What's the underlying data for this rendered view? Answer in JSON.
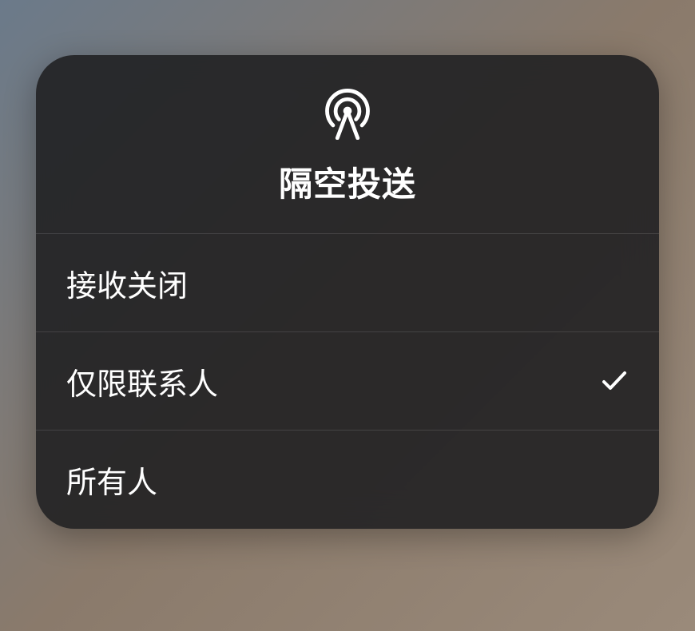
{
  "header": {
    "title": "隔空投送",
    "icon_name": "airdrop-icon"
  },
  "options": [
    {
      "label": "接收关闭",
      "selected": false
    },
    {
      "label": "仅限联系人",
      "selected": true
    },
    {
      "label": "所有人",
      "selected": false
    }
  ]
}
